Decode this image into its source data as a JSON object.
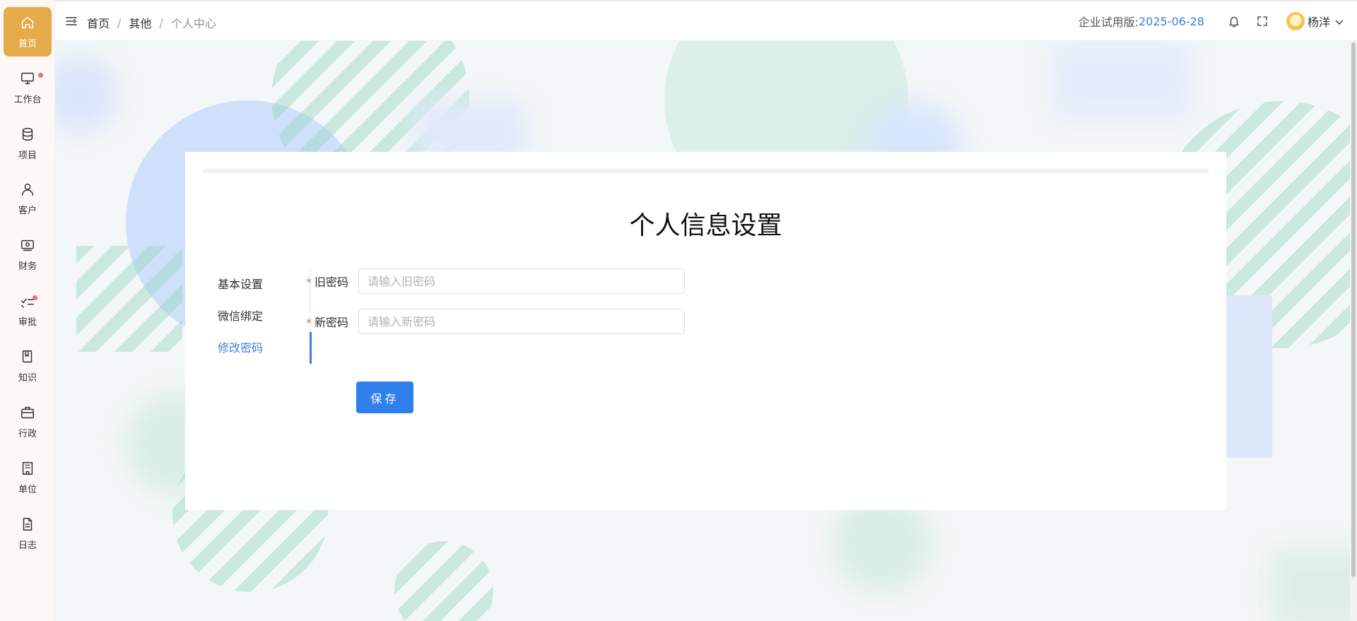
{
  "sidebar": {
    "items": [
      {
        "label": "首页",
        "icon": "home-icon",
        "active": true
      },
      {
        "label": "工作台",
        "icon": "monitor-icon",
        "badge": true
      },
      {
        "label": "项目",
        "icon": "database-icon"
      },
      {
        "label": "客户",
        "icon": "user-icon"
      },
      {
        "label": "财务",
        "icon": "wallet-icon"
      },
      {
        "label": "审批",
        "icon": "checklist-icon",
        "badge": true
      },
      {
        "label": "知识",
        "icon": "book-icon"
      },
      {
        "label": "行政",
        "icon": "briefcase-icon"
      },
      {
        "label": "单位",
        "icon": "building-icon"
      },
      {
        "label": "日志",
        "icon": "document-icon"
      }
    ]
  },
  "header": {
    "breadcrumb": [
      "首页",
      "其他",
      "个人中心"
    ],
    "separator": "/",
    "trial_label": "企业试用版:",
    "trial_date": "2025-06-28",
    "username": "杨洋"
  },
  "card": {
    "title": "个人信息设置",
    "tabs": [
      "基本设置",
      "微信绑定",
      "修改密码"
    ],
    "active_tab": "修改密码",
    "form": {
      "old_password": {
        "label": "旧密码",
        "placeholder": "请输入旧密码",
        "value": ""
      },
      "new_password": {
        "label": "新密码",
        "placeholder": "请输入新密码",
        "value": ""
      },
      "required_mark": "*"
    },
    "save_label": "保存"
  },
  "colors": {
    "accent": "#3f7fe0",
    "sidebar_active": "#e5ab4a",
    "button": "#2f80ed",
    "required": "#f56c6c"
  }
}
